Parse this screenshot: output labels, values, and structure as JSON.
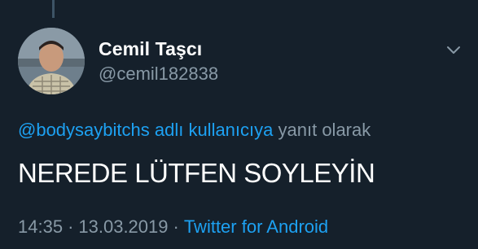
{
  "tweet": {
    "author": {
      "display_name": "Cemil Taşcı",
      "handle": "@cemil182838"
    },
    "reply_to": {
      "mention": "@bodysaybitchs adlı kullanıcıya",
      "suffix": "yanıt olarak"
    },
    "text": "NEREDE LÜTFEN SOYLEYİN",
    "meta": {
      "time": "14:35",
      "separator": "·",
      "date": "13.03.2019",
      "source": "Twitter for Android"
    }
  },
  "colors": {
    "background": "#15202b",
    "link": "#1da1f2",
    "secondary_text": "#8899a6",
    "primary_text": "#ffffff"
  },
  "icons": {
    "menu": "chevron-down-icon"
  }
}
